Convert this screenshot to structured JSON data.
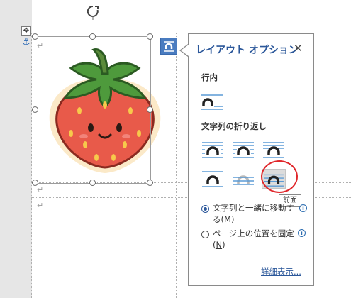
{
  "popup": {
    "title": "レイアウト オプション",
    "close_icon": "close-icon",
    "section_inline": "行内",
    "section_wrap": "文字列の折り返し",
    "tooltip": "前面",
    "radio_move": {
      "label_a": "文字列と一緒に移動す",
      "label_b": "る(",
      "key": "M",
      "label_c": ")",
      "selected": true
    },
    "radio_fix": {
      "label_a": "ページ上の位置を固定",
      "label_b": "(",
      "key": "N",
      "label_c": ")",
      "selected": false
    },
    "more_link": "詳細表示..."
  },
  "document": {
    "paragraph_mark": "↵",
    "image": "strawberry-image"
  },
  "colors": {
    "accent": "#2b579a",
    "highlight_circle": "#e0262a",
    "strawberry": "#e85a4a",
    "leaves": "#4e9a3c"
  }
}
